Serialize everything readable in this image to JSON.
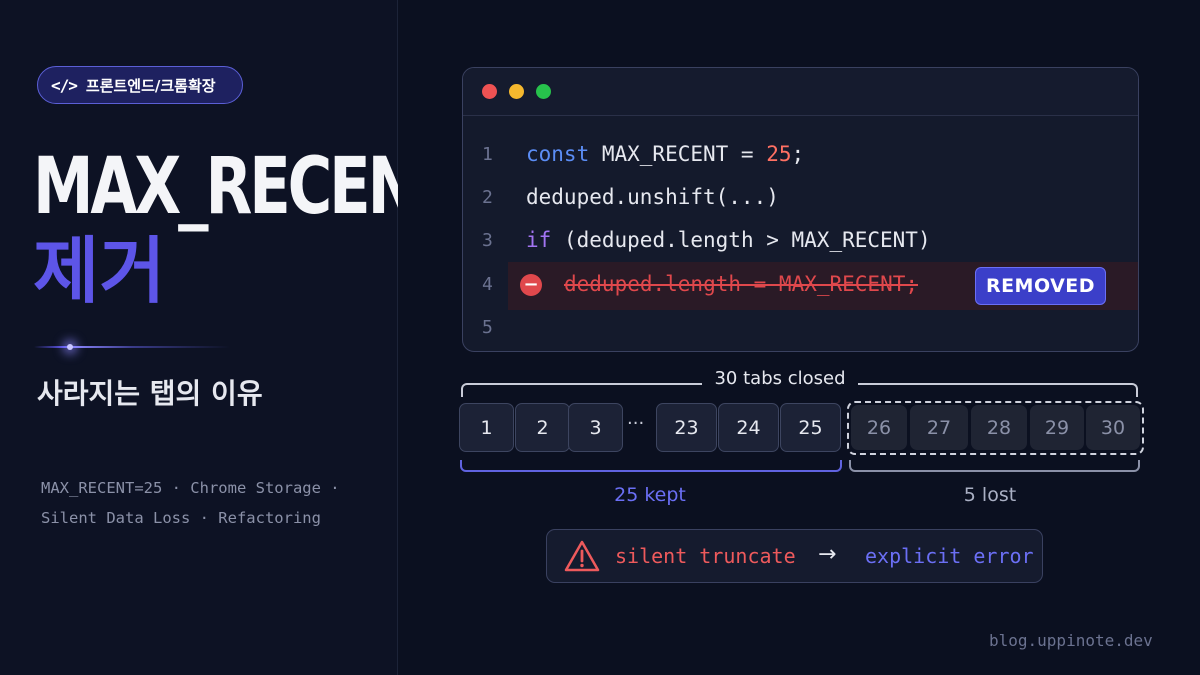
{
  "tag": {
    "icon": "</>",
    "label": "프론트엔드/크롬확장"
  },
  "title": {
    "line1": "MAX_RECENT",
    "line2": "제거"
  },
  "subtitle": "사라지는 탭의 이유",
  "meta": {
    "line1": "MAX_RECENT=25 · Chrome Storage ·",
    "line2": "Silent Data Loss · Refactoring"
  },
  "code": {
    "lines": [
      {
        "num": "1",
        "kw": "const",
        "text": " MAX_RECENT = ",
        "value": "25",
        "tail": ";"
      },
      {
        "num": "2",
        "text": "deduped.unshift(...)"
      },
      {
        "num": "3",
        "kw": "if",
        "text": " (deduped.length > MAX_RECENT)"
      },
      {
        "num": "4",
        "text": "deduped.length = MAX_RECENT;",
        "minus": "−"
      },
      {
        "num": "5",
        "text": ""
      }
    ],
    "removed_badge": "REMOVED"
  },
  "tabs": {
    "closed_label": "30 tabs closed",
    "kept": [
      "1",
      "2",
      "3",
      "23",
      "24",
      "25"
    ],
    "ellipsis": "···",
    "lost": [
      "26",
      "27",
      "28",
      "29",
      "30"
    ],
    "kept_label": "25 kept",
    "lost_label": "5 lost"
  },
  "callout": {
    "from": "silent truncate",
    "arrow": "→",
    "to": "explicit error",
    "icon": "warning-triangle-icon"
  },
  "footer": "blog.uppinote.dev",
  "colors": {
    "accent": "#5d55e8",
    "removed": "#e0484c",
    "background": "#0b1020"
  }
}
